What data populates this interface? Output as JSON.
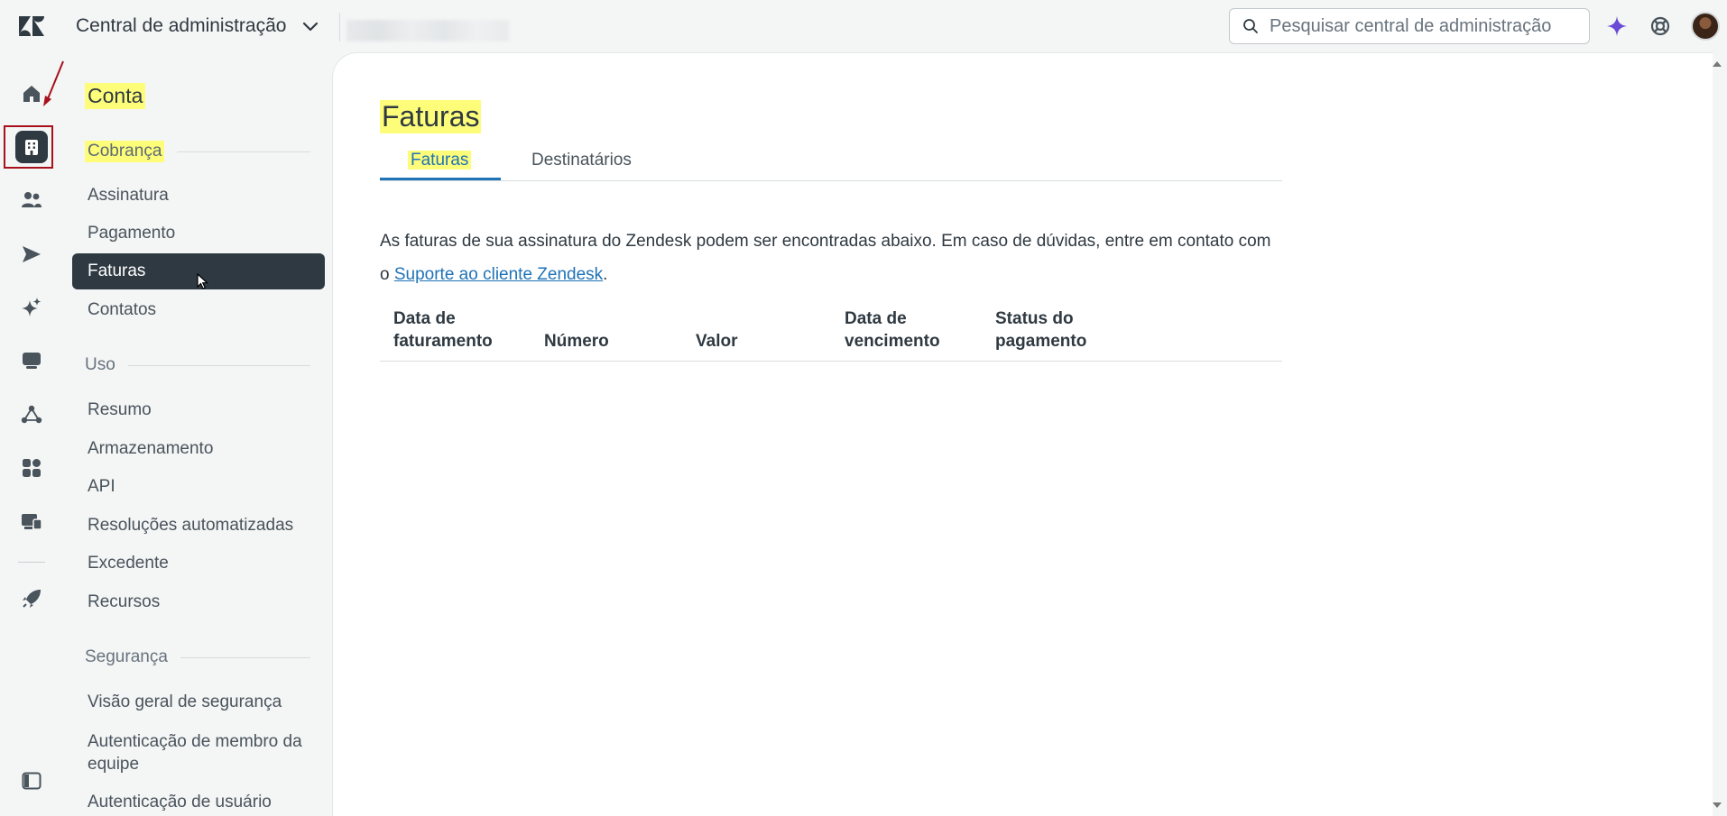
{
  "header": {
    "app_title": "Central de administração",
    "search_placeholder": "Pesquisar central de administração"
  },
  "rail": {
    "icons": [
      "home-icon",
      "building-icon",
      "people-icon",
      "send-icon",
      "sparkle-icon",
      "chat-icon",
      "objects-icon",
      "apps-icon",
      "workspace-icon",
      "rocket-icon",
      "sidebar-toggle-icon"
    ]
  },
  "nav": {
    "title": "Conta",
    "sections": [
      {
        "label": "Cobrança",
        "items": [
          "Assinatura",
          "Pagamento",
          "Faturas",
          "Contatos"
        ]
      },
      {
        "label": "Uso",
        "items": [
          "Resumo",
          "Armazenamento",
          "API",
          "Resoluções automatizadas",
          "Excedente",
          "Recursos"
        ]
      },
      {
        "label": "Segurança",
        "items": [
          "Visão geral de segurança",
          "Autenticação de membro da equipe",
          "Autenticação de usuário"
        ]
      }
    ],
    "active_item": "Faturas"
  },
  "main": {
    "page_title": "Faturas",
    "tabs": [
      "Faturas",
      "Destinatários"
    ],
    "description_prefix": "As faturas de sua assinatura do Zendesk podem ser encontradas abaixo. Em caso de dúvidas, entre em contato com o ",
    "description_link": "Suporte ao cliente Zendesk",
    "description_suffix": ".",
    "table_headers": [
      [
        "Data de",
        "faturamento"
      ],
      [
        "Número"
      ],
      [
        "Valor"
      ],
      [
        "Data de",
        "vencimento"
      ],
      [
        "Status do",
        "pagamento"
      ]
    ]
  },
  "colors": {
    "highlight": "#fdfd7a",
    "active_bg": "#2f3941",
    "link": "#1f73b7",
    "annotation": "#a6111b"
  }
}
